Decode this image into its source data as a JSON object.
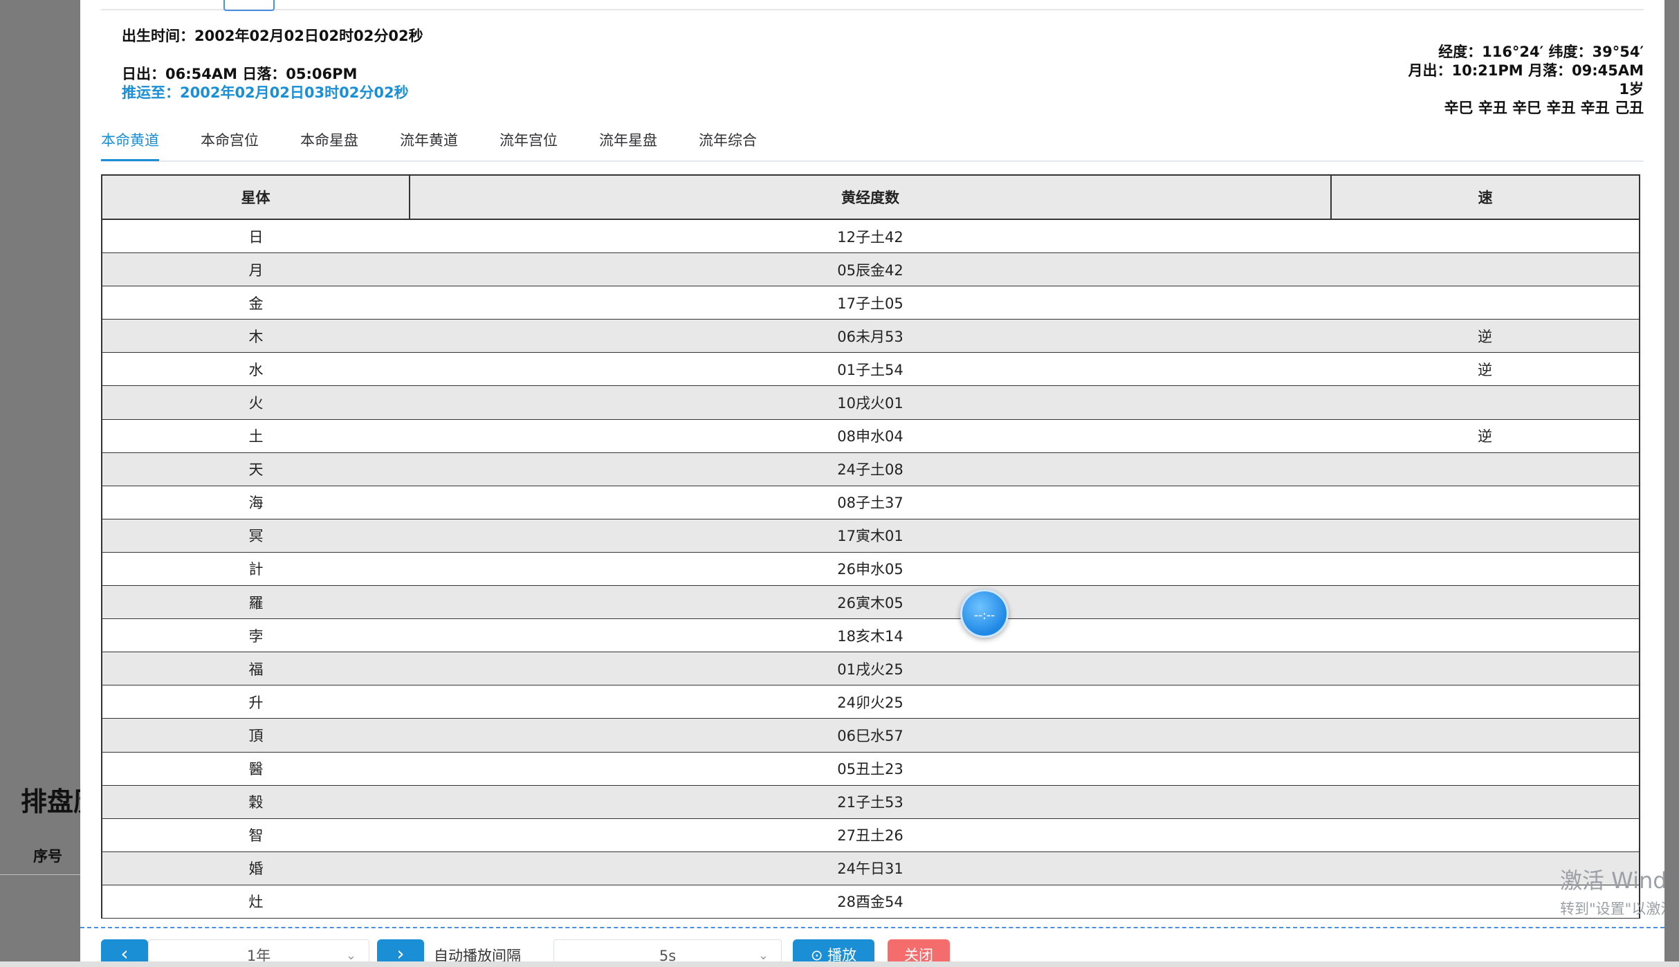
{
  "background": {
    "title": "排盘历",
    "column_header": "序号"
  },
  "birth": {
    "time_label": "出生时间：2002年02月02日02时02分02秒",
    "sun_label": "日出：06:54AM 日落：05:06PM",
    "progress_label": "推运至：2002年02月02日03时02分02秒",
    "geo": "经度：116°24′ 纬度：39°54′",
    "moon": "月出：10:21PM 月落：09:45AM",
    "age": "1岁",
    "bazi": "辛巳 辛丑 辛巳 辛丑 辛丑 己丑"
  },
  "tabs": [
    {
      "label": "本命黄道",
      "active": true
    },
    {
      "label": "本命宫位",
      "active": false
    },
    {
      "label": "本命星盘",
      "active": false
    },
    {
      "label": "流年黄道",
      "active": false
    },
    {
      "label": "流年宫位",
      "active": false
    },
    {
      "label": "流年星盘",
      "active": false
    },
    {
      "label": "流年综合",
      "active": false
    }
  ],
  "table": {
    "headers": [
      "星体",
      "黄经度数",
      "速"
    ],
    "rows": [
      [
        "日",
        "12子土42",
        ""
      ],
      [
        "月",
        "05辰金42",
        ""
      ],
      [
        "金",
        "17子土05",
        ""
      ],
      [
        "木",
        "06未月53",
        "逆"
      ],
      [
        "水",
        "01子土54",
        "逆"
      ],
      [
        "火",
        "10戌火01",
        ""
      ],
      [
        "土",
        "08申水04",
        "逆"
      ],
      [
        "天",
        "24子土08",
        ""
      ],
      [
        "海",
        "08子土37",
        ""
      ],
      [
        "冥",
        "17寅木01",
        ""
      ],
      [
        "計",
        "26申水05",
        ""
      ],
      [
        "羅",
        "26寅木05",
        ""
      ],
      [
        "孛",
        "18亥木14",
        ""
      ],
      [
        "福",
        "01戌火25",
        ""
      ],
      [
        "升",
        "24卯火25",
        ""
      ],
      [
        "頂",
        "06巳水57",
        ""
      ],
      [
        "醫",
        "05丑土23",
        ""
      ],
      [
        "穀",
        "21子土53",
        ""
      ],
      [
        "智",
        "27丑土26",
        ""
      ],
      [
        "婚",
        "24午日31",
        ""
      ],
      [
        "灶",
        "28酉金54",
        ""
      ]
    ]
  },
  "floating_button": {
    "text": "--:--"
  },
  "controls": {
    "prev_icon": "‹",
    "next_icon": "›",
    "step_value": "1年",
    "auto_label": "自动播放间隔",
    "interval_value": "5s",
    "play_label": "播放",
    "close_label": "关闭"
  },
  "watermark": {
    "line1": "激活 Windows",
    "line2": "转到\"设置\"以激活 Windows。"
  },
  "colors": {
    "accent": "#1a8fd6",
    "danger": "#f56c6c",
    "row_alt": "#e8e8e8"
  }
}
